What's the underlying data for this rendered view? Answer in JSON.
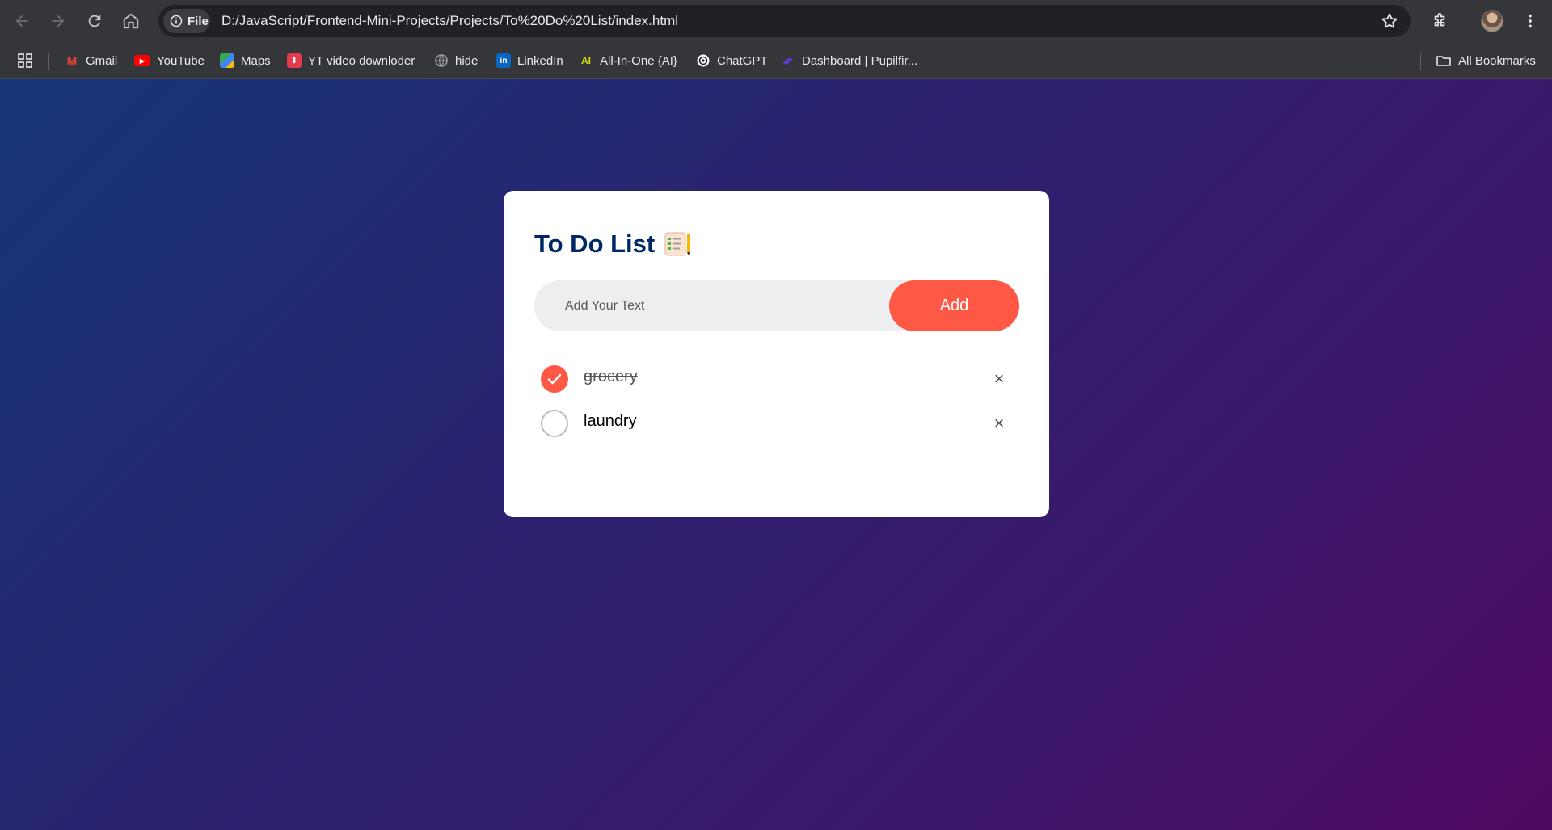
{
  "browser": {
    "url": "D:/JavaScript/Frontend-Mini-Projects/Projects/To%20Do%20List/index.html",
    "site_chip_label": "File",
    "bookmarks": [
      {
        "label": "Gmail",
        "icon": "gmail-icon",
        "color": "#ea4335"
      },
      {
        "label": "YouTube",
        "icon": "youtube-icon",
        "color": "#ff0000"
      },
      {
        "label": "Maps",
        "icon": "maps-icon",
        "color": "#34a853"
      },
      {
        "label": "YT video downloder",
        "icon": "download-icon",
        "color": "#e53950"
      },
      {
        "label": "hide",
        "icon": "globe-icon",
        "color": "#9aa0a6"
      },
      {
        "label": "LinkedIn",
        "icon": "linkedin-icon",
        "color": "#0a66c2"
      },
      {
        "label": "All-In-One {AI}",
        "icon": "ai-icon",
        "color": "#d4e000"
      },
      {
        "label": "ChatGPT",
        "icon": "chatgpt-icon",
        "color": "#ffffff"
      },
      {
        "label": "Dashboard | Pupilfir...",
        "icon": "dashboard-icon",
        "color": "#5b3cc4"
      }
    ],
    "all_bookmarks_label": "All Bookmarks"
  },
  "app": {
    "title": "To Do List",
    "input_placeholder": "Add Your Text",
    "add_label": "Add",
    "accent_color": "#ff5945",
    "title_color": "#002765",
    "tasks": [
      {
        "text": "grocery",
        "done": true,
        "delete_label": "×"
      },
      {
        "text": "laundry",
        "done": false,
        "delete_label": "×"
      }
    ]
  }
}
